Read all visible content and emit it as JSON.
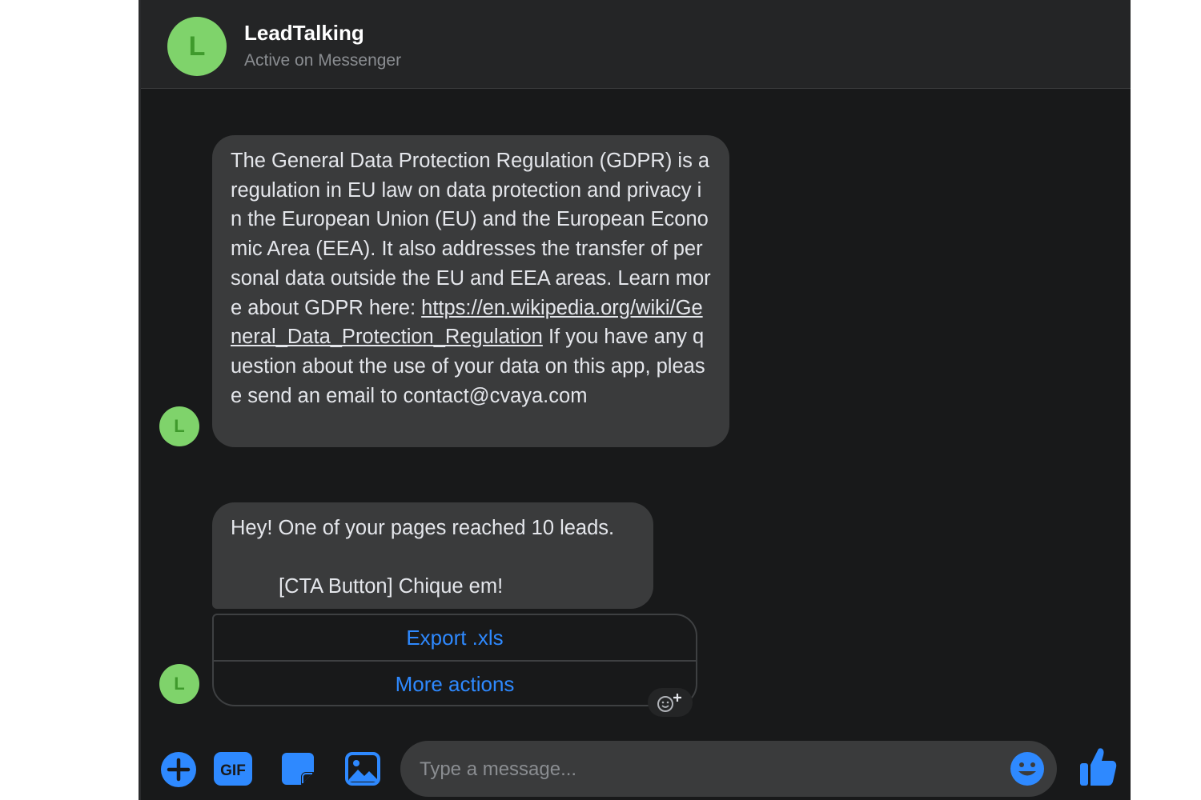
{
  "header": {
    "avatar_letter": "L",
    "name": "LeadTalking",
    "status": "Active on Messenger"
  },
  "messages": [
    {
      "avatar_letter": "L",
      "text_before_link": "The General Data Protection Regulation (GDPR) is a regulation in EU law on data protection and privacy in the European Union (EU) and the European Economic Area (EEA). It also addresses the transfer of personal data outside the EU and EEA areas. Learn more about GDPR here: ",
      "link": "https://en.wikipedia.org/wiki/General_Data_Protection_Regulation",
      "text_after_link": " If you have any question about the use of your data on this app, please send an email to contact@cvaya.com"
    },
    {
      "avatar_letter": "L",
      "text": "Hey! One of your pages reached 10 leads.",
      "cta_text": "[CTA Button] Chique em!",
      "actions": [
        {
          "label": "Export .xls"
        },
        {
          "label": "More actions"
        }
      ]
    }
  ],
  "composer": {
    "placeholder": "Type a message...",
    "icons": [
      "plus-circle-icon",
      "gif-icon",
      "sticker-icon",
      "image-icon",
      "emoji-icon",
      "thumbs-up-icon"
    ],
    "gif_label": "GIF"
  },
  "colors": {
    "accent": "#2e89ff",
    "avatar_bg": "#7fd36b",
    "avatar_fg": "#3f9a2c",
    "bubble_bg": "#3a3b3c",
    "header_bg": "#242526",
    "chat_bg": "#18191a"
  }
}
